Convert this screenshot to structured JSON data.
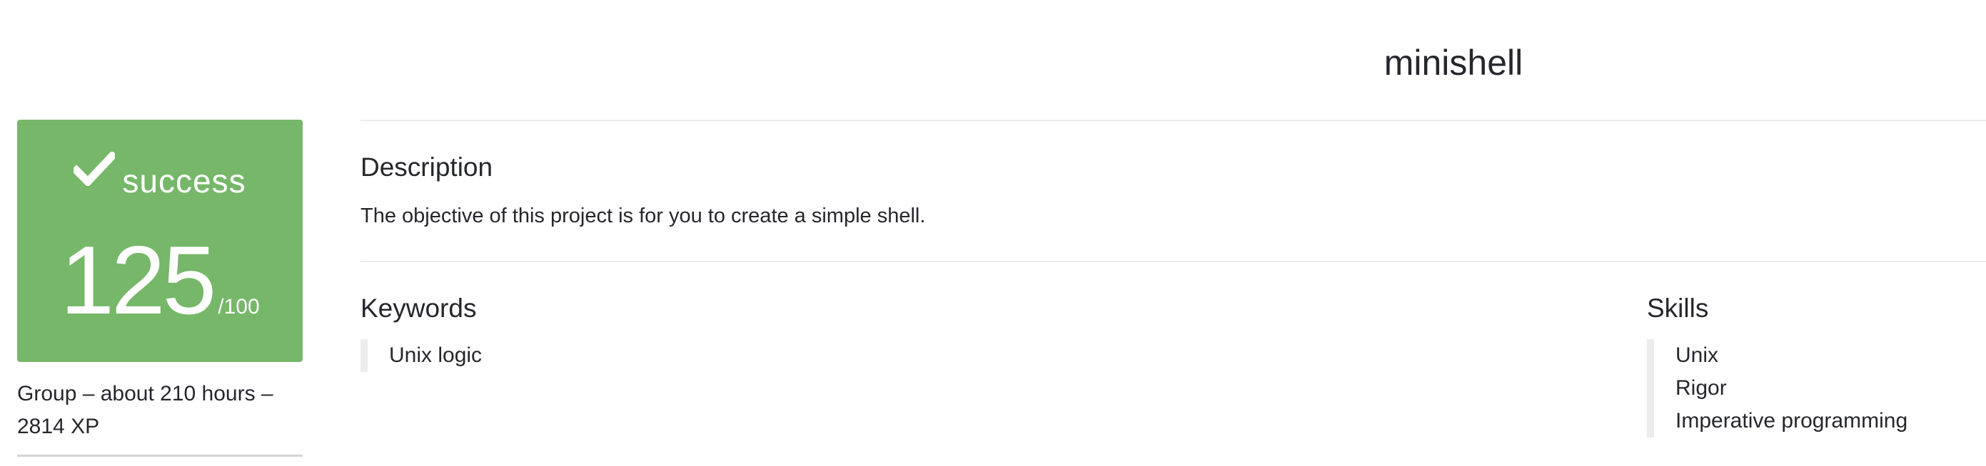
{
  "project": {
    "title": "minishell"
  },
  "grade": {
    "status_icon": "check-icon",
    "status": "success",
    "score": "125",
    "max": "/100",
    "color": "#76b769"
  },
  "meta": {
    "line1": "Group – about 210 hours –",
    "line2": "2814 XP"
  },
  "description": {
    "heading": "Description",
    "text": "The objective of this project is for you to create a simple shell."
  },
  "keywords": {
    "heading": "Keywords",
    "items": [
      "Unix logic"
    ]
  },
  "skills": {
    "heading": "Skills",
    "items": [
      "Unix",
      "Rigor",
      "Imperative programming"
    ]
  }
}
